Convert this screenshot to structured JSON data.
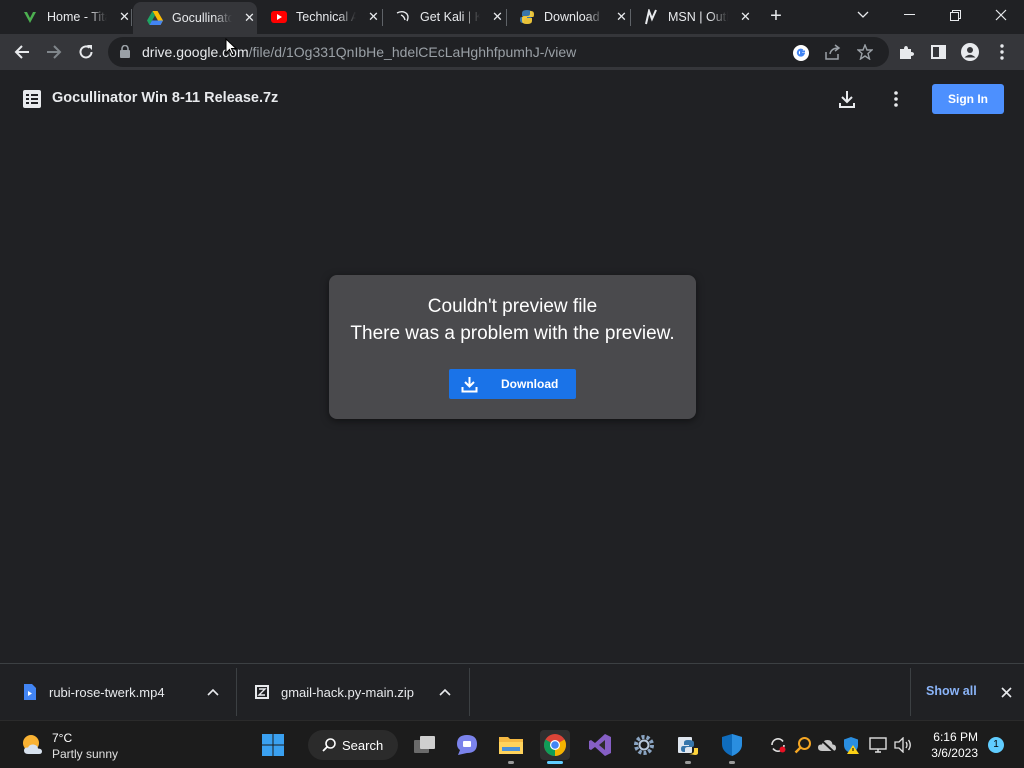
{
  "browser": {
    "tabs": [
      {
        "title": "Home - Titan",
        "active": false
      },
      {
        "title": "Gocullinator",
        "active": true
      },
      {
        "title": "Technical A",
        "active": false
      },
      {
        "title": "Get Kali | K",
        "active": false
      },
      {
        "title": "Download",
        "active": false
      },
      {
        "title": "MSN | Outlook",
        "active": false
      }
    ],
    "url_host": "drive.google.com",
    "url_path": "/file/d/1Og331QnIbHe_hdelCEcLaHghhfpumhJ-/view"
  },
  "drive": {
    "file_name": "Gocullinator Win 8-11 Release.7z",
    "sign_in_label": "Sign In"
  },
  "preview_error": {
    "title": "Couldn't preview file",
    "message": "There was a problem with the preview.",
    "download_label": "Download"
  },
  "download_shelf": {
    "items": [
      {
        "file_name": "rubi-rose-twerk.mp4"
      },
      {
        "file_name": "gmail-hack.py-main.zip"
      }
    ],
    "show_all_label": "Show all"
  },
  "taskbar": {
    "weather_temp": "7°C",
    "weather_desc": "Partly sunny",
    "search_label": "Search",
    "time": "6:16 PM",
    "date": "3/6/2023",
    "notification_count": "1"
  },
  "colors": {
    "accent_blue": "#1a73e8",
    "signin_blue": "#4d90fe",
    "windows_accent": "#60cdff"
  }
}
